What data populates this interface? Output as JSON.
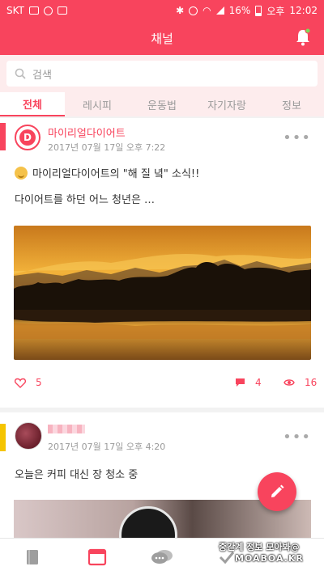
{
  "status_bar": {
    "carrier": "SKT",
    "battery": "16%",
    "ampm": "오후",
    "time": "12:02"
  },
  "app_bar": {
    "title": "채널"
  },
  "search": {
    "placeholder": "검색"
  },
  "tabs": [
    {
      "label": "전체",
      "active": true
    },
    {
      "label": "레시피",
      "active": false
    },
    {
      "label": "운동법",
      "active": false
    },
    {
      "label": "자기자랑",
      "active": false
    },
    {
      "label": "정보",
      "active": false
    }
  ],
  "posts": [
    {
      "author": "마이리얼다이어트",
      "avatar_letter": "D",
      "timestamp": "2017년 07월 17일 오후 7:22",
      "title": "마이리얼다이어트의 \"해 질 녘\" 소식!!",
      "body": "다이어트를 하던 어느 청년은 …",
      "likes": "5",
      "comments": "4",
      "views": "16",
      "accent_color": "#f8445d"
    },
    {
      "timestamp": "2017년 07월 17일 오후 4:20",
      "body": "오늘은 커피 대신 장 청소 중",
      "accent_color": "#f5c400"
    }
  ],
  "watermark": {
    "line1": "중간계 정보 모아봐@",
    "line2": "MOABOA.KR"
  },
  "colors": {
    "accent": "#f8445d",
    "tint": "#fdeced"
  }
}
